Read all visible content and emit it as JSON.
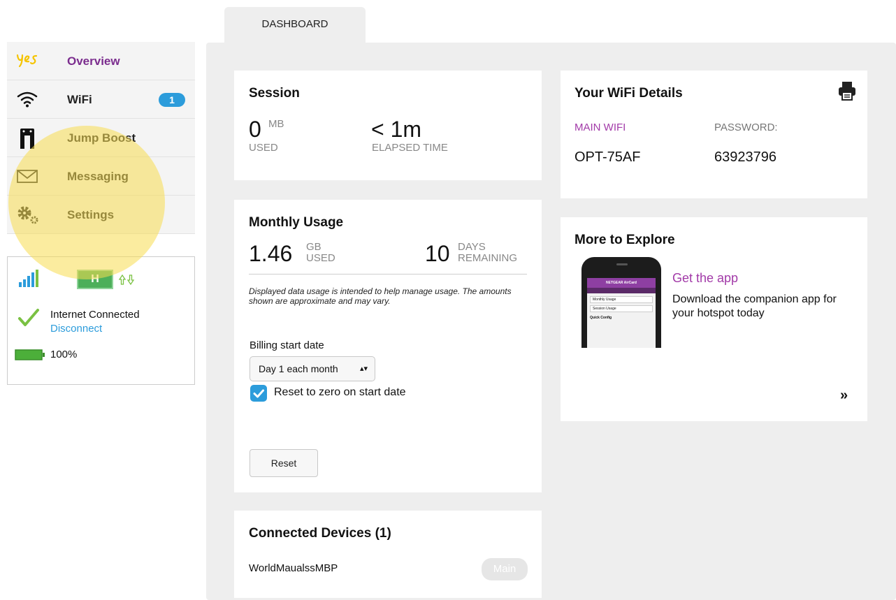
{
  "tab": {
    "label": "DASHBOARD"
  },
  "brand": {
    "logo_text": "yes"
  },
  "sidebar": {
    "items": [
      {
        "label": "Overview",
        "icon": "yes-logo-icon",
        "active": true
      },
      {
        "label": "WiFi",
        "icon": "wifi-icon",
        "badge": "1"
      },
      {
        "label": "Jump Boost",
        "icon": "jump-boost-icon"
      },
      {
        "label": "Messaging",
        "icon": "envelope-icon"
      },
      {
        "label": "Settings",
        "icon": "gears-icon"
      }
    ]
  },
  "status": {
    "network_type": "H",
    "connection_text": "Internet Connected",
    "disconnect_label": "Disconnect",
    "battery": "100%",
    "battery_level": 1.0
  },
  "session": {
    "title": "Session",
    "used_value": "0",
    "used_unit": "MB",
    "used_label": "USED",
    "elapsed_value": "< 1m",
    "elapsed_label": "ELAPSED TIME"
  },
  "wifi_details": {
    "title": "Your WiFi Details",
    "network_label": "MAIN WIFI",
    "password_label": "PASSWORD:",
    "network_value": "OPT-75AF",
    "password_value": "63923796"
  },
  "monthly": {
    "title": "Monthly Usage",
    "used_value": "1.46",
    "used_unit1": "GB",
    "used_unit2": "USED",
    "days_value": "10",
    "days_unit1": "DAYS",
    "days_unit2": "REMAINING",
    "disclaimer": "Displayed data usage is intended to help manage usage. The amounts shown are approximate and may vary.",
    "billing_label": "Billing start date",
    "billing_selected": "Day 1 each month",
    "reset_checkbox_label": "Reset to zero on start date",
    "reset_checked": true,
    "reset_button": "Reset"
  },
  "explore": {
    "title": "More to Explore",
    "link_title": "Get the app",
    "description": "Download the companion app for your hotspot today",
    "more": "»",
    "phone_brand": "NETGEAR AirCard",
    "phone_rows": [
      "Monthly Usage",
      "Session Usage",
      "Quick Config"
    ]
  },
  "devices": {
    "title": "Connected Devices (1)",
    "list": [
      {
        "name": "WorldMaualssMBP",
        "tag": "Main"
      }
    ]
  },
  "colors": {
    "accent_purple": "#7b2d8e",
    "link_blue": "#2c9cdb",
    "brand_yellow": "#f5c400",
    "check_green": "#7ac142",
    "battery_green": "#4caf3a"
  }
}
